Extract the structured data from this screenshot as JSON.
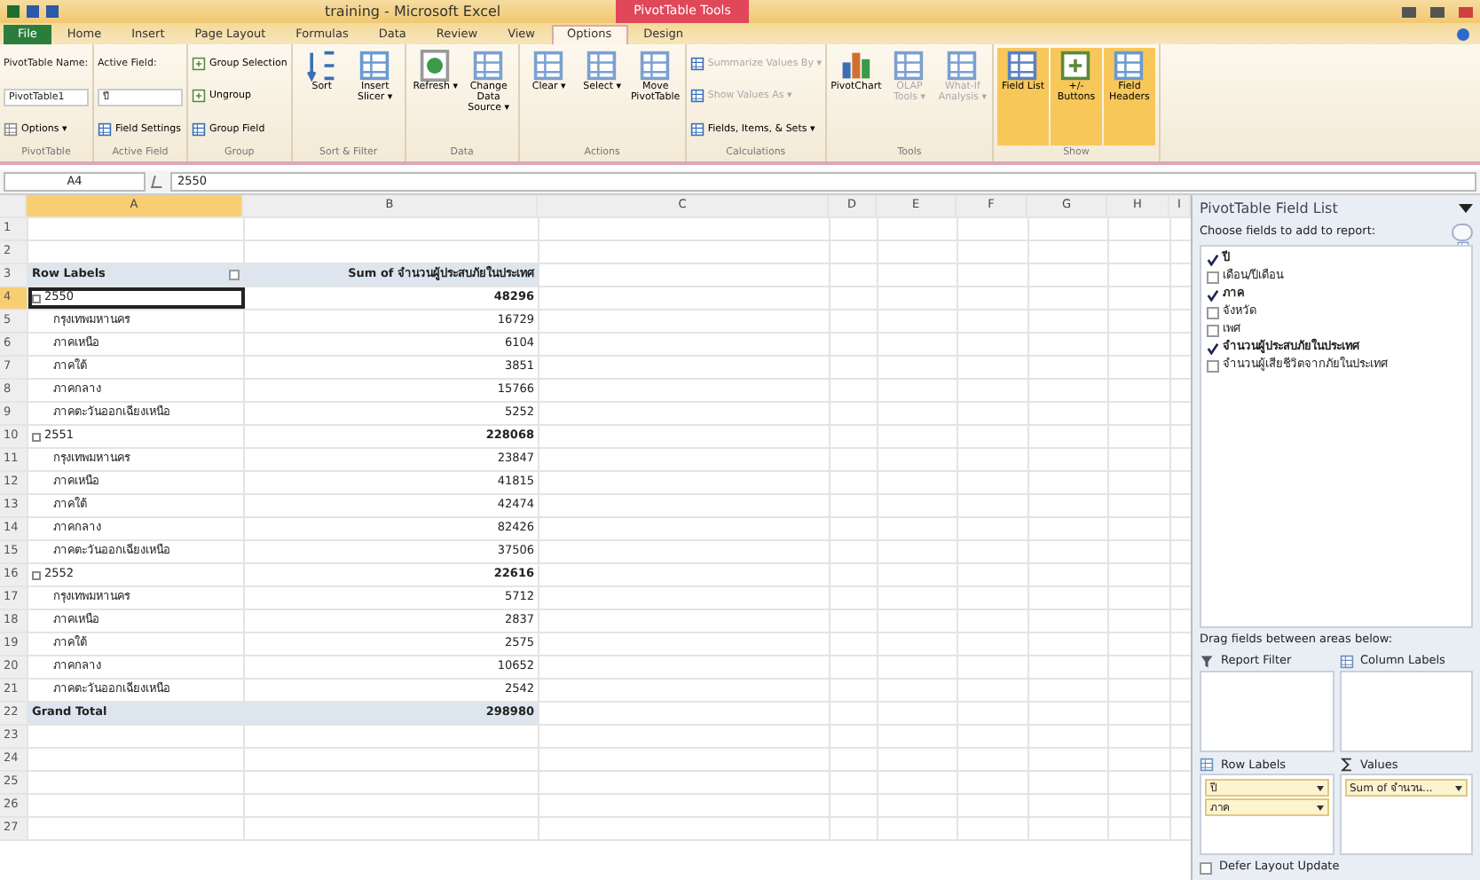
{
  "window": {
    "title": "training - Microsoft Excel",
    "contextual_tab": "PivotTable Tools"
  },
  "tabs": [
    {
      "label": "File",
      "selected": false,
      "kind": "file"
    },
    {
      "label": "Home",
      "selected": false
    },
    {
      "label": "Insert",
      "selected": false
    },
    {
      "label": "Page Layout",
      "selected": false
    },
    {
      "label": "Formulas",
      "selected": false
    },
    {
      "label": "Data",
      "selected": false
    },
    {
      "label": "Review",
      "selected": false
    },
    {
      "label": "View",
      "selected": false
    },
    {
      "label": "Options",
      "selected": true
    },
    {
      "label": "Design",
      "selected": false
    }
  ],
  "ribbon": [
    {
      "label": "PivotTable",
      "items": [
        {
          "kind": "text",
          "label": "PivotTable Name:"
        },
        {
          "kind": "field",
          "label": "PivotTable1"
        },
        {
          "kind": "small",
          "label": "Options ▾"
        }
      ]
    },
    {
      "label": "Active Field",
      "items": [
        {
          "kind": "text",
          "label": "Active Field:"
        },
        {
          "kind": "field",
          "label": "ปี"
        },
        {
          "kind": "small",
          "label": "Field Settings"
        }
      ]
    },
    {
      "label": "Group",
      "items": [
        {
          "kind": "small",
          "label": "Group Selection"
        },
        {
          "kind": "small",
          "label": "Ungroup"
        },
        {
          "kind": "small",
          "label": "Group Field"
        }
      ]
    },
    {
      "label": "Sort & Filter",
      "items": [
        {
          "kind": "large",
          "label": "Sort"
        },
        {
          "kind": "large",
          "label": "Insert Slicer ▾"
        }
      ]
    },
    {
      "label": "Data",
      "items": [
        {
          "kind": "large",
          "label": "Refresh ▾"
        },
        {
          "kind": "large",
          "label": "Change Data Source ▾"
        }
      ]
    },
    {
      "label": "Actions",
      "items": [
        {
          "kind": "large",
          "label": "Clear ▾"
        },
        {
          "kind": "large",
          "label": "Select ▾"
        },
        {
          "kind": "large",
          "label": "Move PivotTable"
        }
      ]
    },
    {
      "label": "Calculations",
      "items": [
        {
          "kind": "small",
          "label": "Summarize Values By ▾",
          "disabled": true
        },
        {
          "kind": "small",
          "label": "Show Values As ▾",
          "disabled": true
        },
        {
          "kind": "small",
          "label": "Fields, Items, & Sets ▾",
          "disabled": false
        }
      ]
    },
    {
      "label": "Tools",
      "items": [
        {
          "kind": "large",
          "label": "PivotChart",
          "disabled": false
        },
        {
          "kind": "large",
          "label": "OLAP Tools ▾",
          "disabled": true
        },
        {
          "kind": "large",
          "label": "What-If Analysis ▾",
          "disabled": true
        }
      ]
    },
    {
      "label": "Show",
      "items": [
        {
          "kind": "large",
          "label": "Field List",
          "on": true
        },
        {
          "kind": "large",
          "label": "+/- Buttons",
          "on": true
        },
        {
          "kind": "large",
          "label": "Field Headers",
          "on": true
        }
      ]
    }
  ],
  "formula_bar": {
    "name_box": "A4",
    "value": "2550"
  },
  "columns": [
    "A",
    "B",
    "C",
    "D",
    "E",
    "F",
    "G",
    "H",
    "I"
  ],
  "pivot": {
    "header": [
      "Row Labels",
      "Sum of จำนวนผู้ประสบภัยในประเทศ"
    ],
    "rows": [
      {
        "kind": "group",
        "label": "2550",
        "value": "48296",
        "selected": true
      },
      {
        "kind": "item",
        "label": "กรุงเทพมหานคร",
        "value": "16729",
        "selected": false
      },
      {
        "kind": "item",
        "label": "ภาคเหนือ",
        "value": "6104",
        "selected": false
      },
      {
        "kind": "item",
        "label": "ภาคใต้",
        "value": "3851",
        "selected": false
      },
      {
        "kind": "item",
        "label": "ภาคกลาง",
        "value": "15766",
        "selected": false
      },
      {
        "kind": "item",
        "label": "ภาคตะวันออกเฉียงเหนือ",
        "value": "5252",
        "selected": false
      },
      {
        "kind": "group",
        "label": "2551",
        "value": "228068",
        "selected": false
      },
      {
        "kind": "item",
        "label": "กรุงเทพมหานคร",
        "value": "23847",
        "selected": false
      },
      {
        "kind": "item",
        "label": "ภาคเหนือ",
        "value": "41815",
        "selected": false
      },
      {
        "kind": "item",
        "label": "ภาคใต้",
        "value": "42474",
        "selected": false
      },
      {
        "kind": "item",
        "label": "ภาคกลาง",
        "value": "82426",
        "selected": false
      },
      {
        "kind": "item",
        "label": "ภาคตะวันออกเฉียงเหนือ",
        "value": "37506",
        "selected": false
      },
      {
        "kind": "group",
        "label": "2552",
        "value": "22616",
        "selected": false
      },
      {
        "kind": "item",
        "label": "กรุงเทพมหานคร",
        "value": "5712",
        "selected": false
      },
      {
        "kind": "item",
        "label": "ภาคเหนือ",
        "value": "2837",
        "selected": false
      },
      {
        "kind": "item",
        "label": "ภาคใต้",
        "value": "2575",
        "selected": false
      },
      {
        "kind": "item",
        "label": "ภาคกลาง",
        "value": "10652",
        "selected": false
      },
      {
        "kind": "item",
        "label": "ภาคตะวันออกเฉียงเหนือ",
        "value": "2542",
        "selected": false
      },
      {
        "kind": "total",
        "label": "Grand Total",
        "value": "298980",
        "selected": false
      }
    ]
  },
  "row_numbers": [
    "1",
    "2",
    "3",
    "4",
    "5",
    "6",
    "7",
    "8",
    "9",
    "10",
    "11",
    "12",
    "13",
    "14",
    "15",
    "16",
    "17",
    "18",
    "19",
    "20",
    "21",
    "22",
    "23",
    "24",
    "25",
    "26",
    "27"
  ],
  "field_list": {
    "title": "PivotTable Field List",
    "instruction": "Choose fields to add to report:",
    "fields": [
      {
        "label": "ปี",
        "checked": true
      },
      {
        "label": "เดือน/ปีเดือน",
        "checked": false
      },
      {
        "label": "ภาค",
        "checked": true
      },
      {
        "label": "จังหวัด",
        "checked": false
      },
      {
        "label": "เพศ",
        "checked": false
      },
      {
        "label": "จำนวนผู้ประสบภัยในประเทศ",
        "checked": true
      },
      {
        "label": "จำนวนผู้เสียชีวิตจากภัยในประเทศ",
        "checked": false
      }
    ],
    "areas_instruction": "Drag fields between areas below:",
    "areas": [
      {
        "label": "Report Filter"
      },
      {
        "label": "Column Labels"
      },
      {
        "label": "Row Labels",
        "items": [
          "ปี",
          "ภาค"
        ]
      },
      {
        "label": "Values",
        "items": [
          "Sum of จำนวน..."
        ]
      }
    ],
    "defer": {
      "label": "Defer Layout Update",
      "checked": false
    }
  }
}
